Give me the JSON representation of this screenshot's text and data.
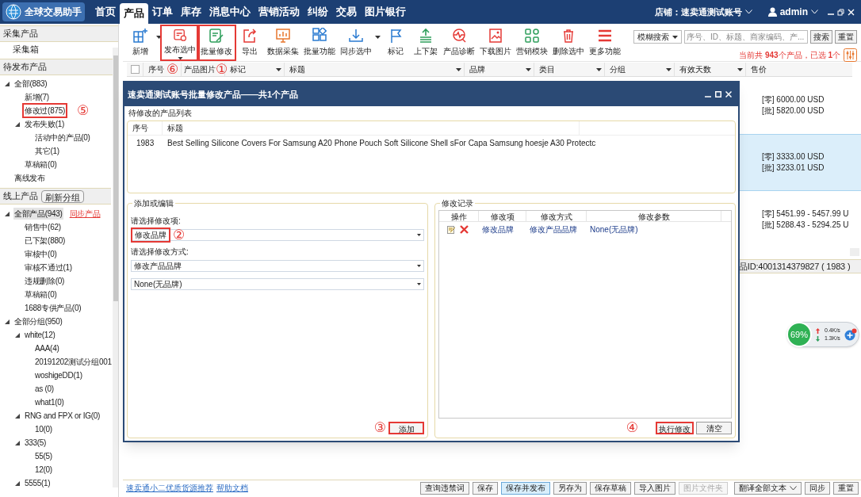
{
  "app": {
    "title": "全球交易助手"
  },
  "nav": {
    "tabs": [
      {
        "label": "首页",
        "selected": false
      },
      {
        "label": "产品",
        "selected": true
      },
      {
        "label": "订单",
        "selected": false
      },
      {
        "label": "库存",
        "selected": false
      },
      {
        "label": "消息中心",
        "selected": false
      },
      {
        "label": "营销活动",
        "selected": false
      },
      {
        "label": "纠纷",
        "selected": false
      },
      {
        "label": "交易",
        "selected": false
      },
      {
        "label": "图片银行",
        "selected": false
      }
    ],
    "shop": "店铺：速卖通测试账号",
    "user": "admin"
  },
  "sidebar": {
    "collect": {
      "title": "采集产品",
      "items": [
        "采集箱"
      ]
    },
    "pending": {
      "title": "待发布产品",
      "tree": [
        {
          "label": "全部(883)",
          "expanded": true,
          "children": [
            {
              "label": "新增(7)"
            },
            {
              "label": "修改过(875)",
              "highlighted": true,
              "callout": "⑤"
            },
            {
              "label": "发布失败(1)",
              "expanded": true,
              "children": [
                {
                  "label": "活动中的产品(0)"
                },
                {
                  "label": "其它(1)"
                }
              ]
            },
            {
              "label": "草稿箱(0)"
            }
          ]
        },
        {
          "label": "离线发布"
        }
      ]
    },
    "online": {
      "title": "线上产品",
      "button": "刷新分组",
      "tree": [
        {
          "label": "全部产品(943)",
          "selected": true,
          "link": "同步产品",
          "expanded": true,
          "children": [
            {
              "label": "销售中(62)"
            },
            {
              "label": "已下架(880)"
            },
            {
              "label": "审核中(0)"
            },
            {
              "label": "审核不通过(1)"
            },
            {
              "label": "违规删除(0)"
            },
            {
              "label": "草稿箱(0)"
            },
            {
              "label": "1688专供产品(0)"
            }
          ]
        },
        {
          "label": "全部分组(950)",
          "expanded": true,
          "children": [
            {
              "label": "white(12)",
              "expanded": true,
              "children": [
                {
                  "label": "AAA(4)"
                },
                {
                  "label": "20191202测试分组001"
                },
                {
                  "label": "woshigeDD(1)"
                },
                {
                  "label": "as (0)"
                },
                {
                  "label": "what1(0)"
                }
              ]
            },
            {
              "label": "RNG and FPX or IG(0)",
              "expanded": true,
              "children": [
                {
                  "label": "10(0)"
                }
              ]
            },
            {
              "label": "333(5)",
              "expanded": true,
              "children": [
                {
                  "label": "55(5)"
                },
                {
                  "label": "12(0)"
                }
              ]
            },
            {
              "label": "5555(1)",
              "expanded": true
            }
          ]
        }
      ]
    }
  },
  "toolbar": {
    "tools": [
      {
        "label": "新增",
        "kind": "split"
      },
      {
        "label": "发布选中",
        "kind": "menu",
        "highlighted": true,
        "callout": "⑥"
      },
      {
        "label": "批量修改",
        "kind": "plain",
        "highlighted": true,
        "callout": "①"
      },
      {
        "label": "导出",
        "kind": "plain"
      },
      {
        "label": "数据采集",
        "kind": "plain"
      },
      {
        "label": "批量功能",
        "kind": "plain"
      },
      {
        "label": "同步选中",
        "kind": "split"
      },
      {
        "label": "标记",
        "kind": "plain"
      },
      {
        "label": "上下架",
        "kind": "plain"
      },
      {
        "label": "产品诊断",
        "kind": "plain"
      },
      {
        "label": "下载图片",
        "kind": "plain"
      },
      {
        "label": "营销模块",
        "kind": "plain"
      },
      {
        "label": "删除选中",
        "kind": "plain"
      },
      {
        "label": "更多功能",
        "kind": "plain"
      }
    ],
    "search_mode": "模糊搜索",
    "search": {
      "placeholder": "序号、ID、标题、商家编码、产..."
    },
    "search_button": "搜索",
    "reset_button": "重置",
    "summary": "当前共 **943**个产品，已选 **1**个"
  },
  "table": {
    "select_all": {
      "checked": false
    },
    "columns": [
      {
        "label": "序号"
      },
      {
        "label": "产品图片"
      },
      {
        "label": "标记",
        "filter": true
      },
      {
        "label": "标题",
        "filter": true
      },
      {
        "label": "品牌",
        "filter": true
      },
      {
        "label": "类目",
        "filter": true
      },
      {
        "label": "分组",
        "filter": true
      },
      {
        "label": "有效天数",
        "filter": true
      },
      {
        "label": "售价"
      }
    ],
    "rows": [
      {
        "selected": false,
        "retail": "[零] 6000.00 USD",
        "wholesale": "[批] 5820.00 USD"
      },
      {
        "selected": true,
        "retail": "[零] 3333.00 USD",
        "wholesale": "[批] 3233.01 USD"
      },
      {
        "selected": false,
        "retail": "[零] 5451.99 - 5457.99 U",
        "wholesale": "[批] 5288.43 - 5294.25 U"
      }
    ]
  },
  "detail_bar": "品ID:4001314379827 ( 1983 )",
  "dialog": {
    "title": "速卖通测试账号批量修改产品——共1个产品",
    "list_label": "待修改的产品列表",
    "list": {
      "columns": [
        "序号",
        "标题"
      ],
      "rows": [
        {
          "no": "1983",
          "title": "Best Selling Silicone Covers For Samsung A20 Phone Pouch Soft Silicone Shell sFor Capa Samsung hoesje A30 Protectc"
        }
      ]
    },
    "edit": {
      "title": "添加或编辑",
      "item_label": "请选择修改项:",
      "item_value": "修改品牌",
      "item_callout": "②",
      "mode_label": "请选择修改方式:",
      "mode_value": "修改产品品牌",
      "param_value": "None(无品牌)",
      "add_button": "添加",
      "add_callout": "③"
    },
    "records": {
      "title": "修改记录",
      "columns": [
        "操作",
        "修改项",
        "修改方式",
        "修改参数"
      ],
      "rows": [
        {
          "item": "修改品牌",
          "mode": "修改产品品牌",
          "param": "None(无品牌)"
        }
      ],
      "run_button": "执行修改",
      "run_callout": "④",
      "clear_button": "清空"
    }
  },
  "net": {
    "percent": "69%",
    "upload": "0.4K/s",
    "download": "1.3K/s"
  },
  "footer": {
    "links": [
      "速卖通小二优质货源推荐",
      "帮助文档"
    ],
    "buttons": [
      {
        "label": "查询违禁词",
        "kind": "normal"
      },
      {
        "label": "保存",
        "kind": "normal"
      },
      {
        "label": "保存并发布",
        "kind": "primary"
      },
      {
        "label": "另存为",
        "kind": "normal"
      },
      {
        "label": "保存草稿",
        "kind": "normal"
      },
      {
        "label": "导入图片",
        "kind": "normal"
      },
      {
        "label": "图片文件夹",
        "kind": "disabled"
      },
      {
        "label": "翻译全部文本",
        "kind": "dropdown"
      },
      {
        "label": "同步",
        "kind": "normal"
      },
      {
        "label": "重置",
        "kind": "normal"
      }
    ]
  }
}
